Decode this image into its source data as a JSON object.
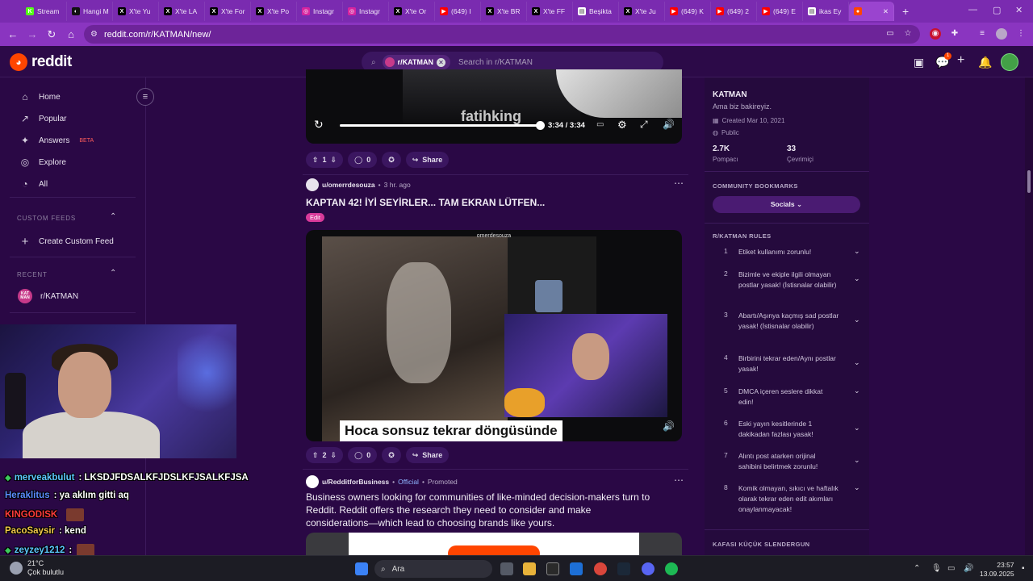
{
  "browser": {
    "tabs": [
      {
        "label": "Stream",
        "color": "#53fc18",
        "glyph": "K"
      },
      {
        "label": "Hangi M",
        "color": "#111111",
        "glyph": "◐"
      },
      {
        "label": "X'te Yu",
        "color": "#000000",
        "glyph": "X"
      },
      {
        "label": "X'te LA",
        "color": "#000000",
        "glyph": "X"
      },
      {
        "label": "X'te For",
        "color": "#000000",
        "glyph": "X"
      },
      {
        "label": "X'te Po",
        "color": "#000000",
        "glyph": "X"
      },
      {
        "label": "Instagr",
        "color": "#d6249f",
        "glyph": "◎"
      },
      {
        "label": "Instagr",
        "color": "#d6249f",
        "glyph": "◎"
      },
      {
        "label": "X'te Or",
        "color": "#000000",
        "glyph": "X"
      },
      {
        "label": "(649) I",
        "color": "#ff0000",
        "glyph": "▶"
      },
      {
        "label": "X'te BR",
        "color": "#000000",
        "glyph": "X"
      },
      {
        "label": "X'te FF",
        "color": "#000000",
        "glyph": "X"
      },
      {
        "label": "Beşikta",
        "color": "#ffffff",
        "glyph": "▤"
      },
      {
        "label": "X'te Ju",
        "color": "#000000",
        "glyph": "X"
      },
      {
        "label": "(649) K",
        "color": "#ff0000",
        "glyph": "▶"
      },
      {
        "label": "(649) 2",
        "color": "#ff0000",
        "glyph": "▶"
      },
      {
        "label": "(649) E",
        "color": "#ff0000",
        "glyph": "▶"
      },
      {
        "label": "ikas Ey",
        "color": "#ffffff",
        "glyph": "▤"
      },
      {
        "label": "",
        "color": "#ff4500",
        "glyph": "●",
        "active": true
      }
    ],
    "url": "reddit.com/r/KATMAN/new/"
  },
  "header": {
    "logo_text": "reddit",
    "search_chip": "r/KATMAN",
    "search_placeholder": "Search in r/KATMAN",
    "notif_count": "1"
  },
  "leftnav": {
    "items": [
      {
        "label": "Home",
        "icon": "⌂"
      },
      {
        "label": "Popular",
        "icon": "↗"
      },
      {
        "label": "Answers",
        "icon": "✦",
        "badge": "BETA"
      },
      {
        "label": "Explore",
        "icon": "◎"
      },
      {
        "label": "All",
        "icon": "◔"
      }
    ],
    "custom_feeds_heading": "CUSTOM FEEDS",
    "create_feed": "Create Custom Feed",
    "recent_heading": "RECENT",
    "recent_item": "r/KATMAN",
    "recent_avatar": "KAT MAN"
  },
  "chat": [
    {
      "user": "merveakbulut",
      "msg": ": LKSDJFDSALKFJDSLKFJSALKFJSA",
      "color": "#5dc8ff",
      "badge": true
    },
    {
      "user": "Heraklitus",
      "msg": ": ya aklım gitti aq",
      "color": "#5b8cff",
      "badge": false
    },
    {
      "user": "KINGODISK",
      "msg": "",
      "color": "#ff3b3b",
      "badge": false,
      "emote": true
    },
    {
      "user": "PacoSaysir",
      "msg": ": kend",
      "color": "#f2c84b",
      "badge": false
    },
    {
      "user": "zeyzey1212",
      "msg": ":",
      "color": "#5dc8ff",
      "badge": true,
      "emote": true
    }
  ],
  "feed": {
    "video1": {
      "watermark": "fatihking",
      "time": "3:34 / 3:34",
      "progress": 1.0,
      "votes": "1",
      "comments": "0",
      "share": "Share"
    },
    "post2": {
      "user": "u/omerrdesouza",
      "age": "3 hr. ago",
      "title": "KAPTAN 42! İYİ SEYİRLER... TAM EKRAN LÜTFEN...",
      "flair": "Edit",
      "video_user": "omerdesouza",
      "caption": "Hoca sonsuz tekrar döngüsünde",
      "votes": "2",
      "comments": "0",
      "share": "Share"
    },
    "post3": {
      "user": "u/RedditforBusiness",
      "official": "Official",
      "promoted": "Promoted",
      "body": "Business owners looking for communities of like-minded decision-makers turn to Reddit. Reddit offers the research they need to choosing brands like yours.",
      "line1": "Business owners looking for communities of like-minded decision-makers turn to",
      "line2": "Reddit. Reddit offers the research they need to consider and make",
      "line3": "considerations—which lead to choosing brands like yours."
    }
  },
  "sidebar": {
    "name": "KATMAN",
    "desc": "Ama biz bakireyiz.",
    "created": "Created Mar 10, 2021",
    "visibility": "Public",
    "members": "2.7K",
    "members_label": "Pompacı",
    "online": "33",
    "online_label": "Çevrimiçi",
    "bookmarks_heading": "COMMUNITY BOOKMARKS",
    "socials": "Socials",
    "rules_heading": "R/KATMAN RULES",
    "rules": [
      {
        "n": "1",
        "t": "Etiket kullanımı zorunlu!"
      },
      {
        "n": "2",
        "t": "Bizimle ve ekiple ilgili olmayan postlar yasak! (İstisnalar olabilir)"
      },
      {
        "n": "3",
        "t": "Abartı/Aşınya kaçmış sad postlar yasak! (İstisnalar olabilir)"
      },
      {
        "n": "4",
        "t": "Birbirini tekrar eden/Aynı postlar yasak!"
      },
      {
        "n": "5",
        "t": "DMCA içeren seslere dikkat edin!"
      },
      {
        "n": "6",
        "t": "Eski yayın kesitlerinde 1 dakikadan fazlası yasak!"
      },
      {
        "n": "7",
        "t": "Alıntı post atarken orijinal sahibini belirtmek zorunlu!"
      },
      {
        "n": "8",
        "t": "Komik olmayan, sıkıcı ve haftalık olarak tekrar eden edit akımları onaylanmayacak!"
      }
    ],
    "footer_heading": "KAFASI KÜÇÜK SLENDERGUN"
  },
  "taskbar": {
    "temp": "21°C",
    "weather": "Çok bulutlu",
    "search": "Ara",
    "time": "23:57",
    "date": "13.09.2025"
  }
}
